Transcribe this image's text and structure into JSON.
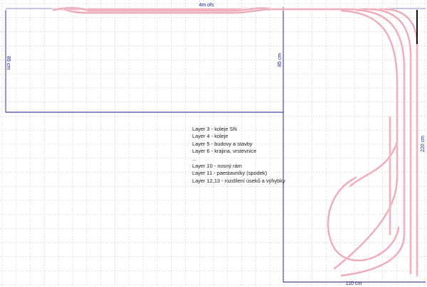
{
  "dimensions": {
    "top_width": "4m ofs",
    "left_height": "85 cm",
    "mid_height": "85 cm",
    "right_height": "220 cm",
    "bottom_width": "110 cm"
  },
  "legend": [
    "Layer 3 - koleje SN",
    "Layer 4 - koleje",
    "Layer 5 - budovy a stavby",
    "Layer 6 - krajina, vrstevnice",
    "...",
    "Layer 10 - nosný rám",
    "Layer 11 - paestavníky (spodek)",
    "Layer 12,13 - rozdílení úseků a výhybky"
  ],
  "colors": {
    "grid": "#cfcfcf",
    "outline": "#1a1a8c",
    "track": "#e88a9a",
    "track_fill": "#f6d3da",
    "accent": "#111111"
  }
}
